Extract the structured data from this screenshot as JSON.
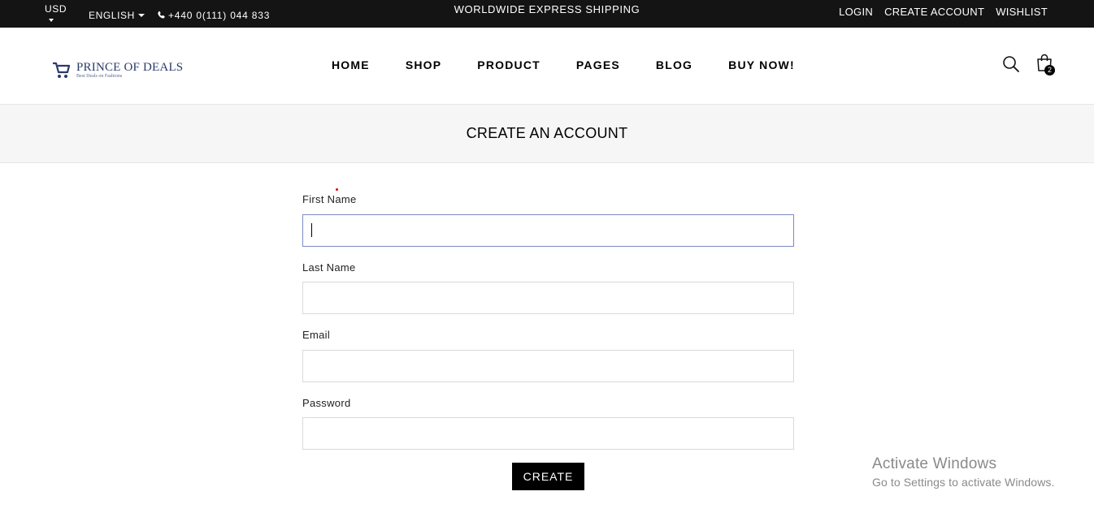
{
  "topbar": {
    "currency": "USD",
    "language": "ENGLISH",
    "phone": "+440 0(111) 044 833",
    "shipping": "WORLDWIDE EXPRESS SHIPPING",
    "links": {
      "login": "LOGIN",
      "create_account": "CREATE ACCOUNT",
      "wishlist": "WISHLIST"
    }
  },
  "header": {
    "brand": "PRINCE OF DEALS",
    "tagline": "Best Deals on Fashions",
    "nav": [
      "HOME",
      "SHOP",
      "PRODUCT",
      "PAGES",
      "BLOG",
      "BUY NOW!"
    ],
    "cart_count": "2",
    "icons": {
      "search": "search-icon",
      "cart": "shopping-bag-icon",
      "phone": "phone-icon",
      "logo": "cart-logo-icon"
    }
  },
  "page": {
    "title": "CREATE AN ACCOUNT"
  },
  "form": {
    "first_name_label": "First Name",
    "first_name_value": "",
    "last_name_label": "Last Name",
    "last_name_value": "",
    "email_label": "Email",
    "email_value": "",
    "password_label": "Password",
    "password_value": "",
    "submit_label": "CREATE"
  },
  "watermark": {
    "title": "Activate Windows",
    "subtitle": "Go to Settings to activate Windows."
  },
  "colors": {
    "topbar_bg": "#141414",
    "title_band_bg": "#f6f6f6",
    "brand": "#2a3a6a",
    "button_bg": "#000000",
    "focus_border": "#7c8bc2"
  }
}
